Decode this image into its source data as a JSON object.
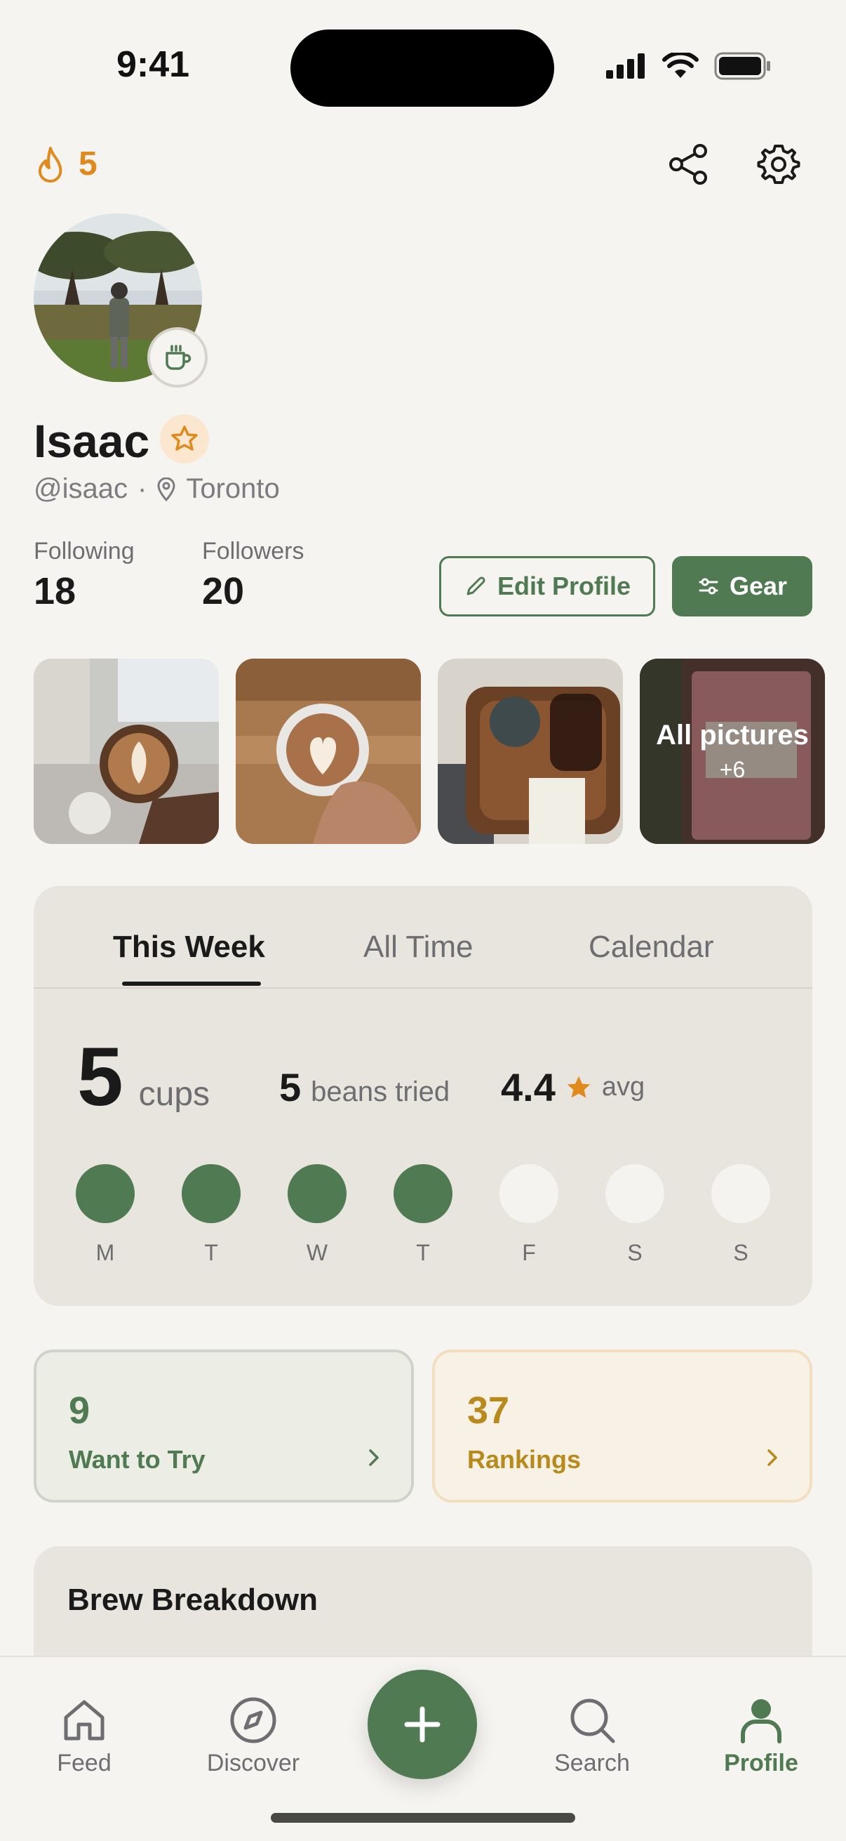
{
  "status_bar": {
    "time": "9:41"
  },
  "header": {
    "streak_count": "5",
    "icons": [
      "flame-icon",
      "share-icon",
      "settings-icon"
    ]
  },
  "profile": {
    "name": "Isaac",
    "handle": "@isaac",
    "separator": "·",
    "location": "Toronto",
    "following_label": "Following",
    "following_count": "18",
    "followers_label": "Followers",
    "followers_count": "20",
    "edit_label": "Edit Profile",
    "gear_label": "Gear"
  },
  "photos": {
    "all_label": "All pictures",
    "more_count": "+6"
  },
  "stats": {
    "tabs": [
      "This Week",
      "All Time",
      "Calendar"
    ],
    "active_tab": "This Week",
    "cups_value": "5",
    "cups_label": "cups",
    "beans_value": "5",
    "beans_label": "beans tried",
    "avg_value": "4.4",
    "avg_label": "avg",
    "days": [
      {
        "label": "M",
        "done": true
      },
      {
        "label": "T",
        "done": true
      },
      {
        "label": "W",
        "done": true
      },
      {
        "label": "T",
        "done": true
      },
      {
        "label": "F",
        "done": false
      },
      {
        "label": "S",
        "done": false
      },
      {
        "label": "S",
        "done": false
      }
    ]
  },
  "want_to_try": {
    "count": "9",
    "label": "Want to Try"
  },
  "rankings": {
    "count": "37",
    "label": "Rankings"
  },
  "brew_breakdown": {
    "title": "Brew Breakdown"
  },
  "nav": {
    "feed": "Feed",
    "discover": "Discover",
    "search": "Search",
    "profile": "Profile"
  },
  "colors": {
    "accent_green": "#4f7a52",
    "streak_orange": "#e08a1e",
    "rankings_gold": "#b88a1c",
    "background": "#f5f4f0"
  }
}
